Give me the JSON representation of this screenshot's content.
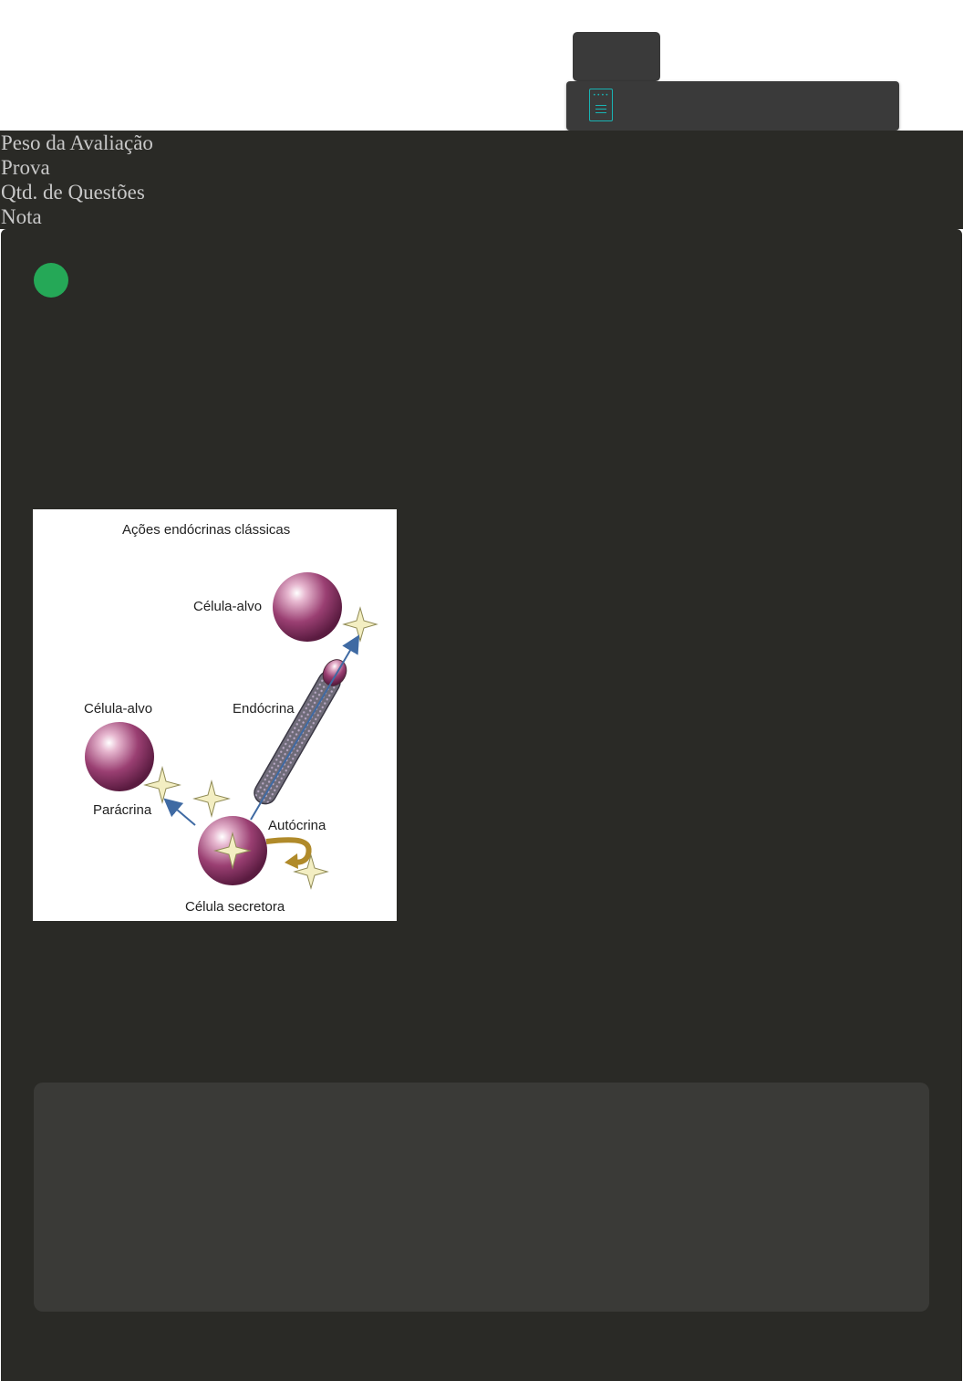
{
  "header": {
    "info_lines": [
      "Peso da Avaliação",
      "Prova",
      "Qtd. de Questões",
      "Nota"
    ]
  },
  "figure": {
    "title": "Ações endócrinas clássicas",
    "labels": {
      "target_cell_top": "Célula-alvo",
      "target_cell_left": "Célula-alvo",
      "endocrine": "Endócrina",
      "paracrine": "Parácrina",
      "autocrine": "Autócrina",
      "secretory_cell": "Célula secretora"
    }
  },
  "icons": {
    "document": "document-icon",
    "status": "status-dot-icon"
  },
  "colors": {
    "accent": "#19b3b3",
    "status_green": "#25a857",
    "background": "#2a2a26"
  }
}
